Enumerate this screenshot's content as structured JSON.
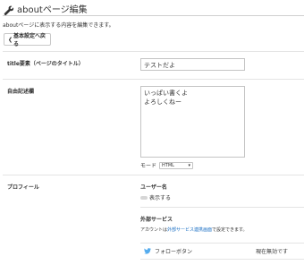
{
  "header": {
    "title": "aboutページ編集",
    "icon": "wrench-icon"
  },
  "description": "aboutページに表示する内容を編集できます。",
  "back_button": {
    "label": "基本設定へ戻る",
    "icon": "chevron-left-icon"
  },
  "form": {
    "title_label": "title要素（ページのタイトル）",
    "title_value": "テストだよ",
    "free_label": "自由記述欄",
    "free_value": "いっぱい書くよ\nよろしくねー",
    "mode_label": "モード",
    "mode_value": "HTML",
    "profile_label": "プロフィール",
    "username_heading": "ユーザー名",
    "show_label": "表示する",
    "external_heading": "外部サービス",
    "external_desc_prefix": "アカウントは",
    "external_desc_link": "外部サービス連携画面",
    "external_desc_suffix": "で設定できます。",
    "follow_label": "フォローボタン",
    "follow_status": "現在無効です"
  },
  "colors": {
    "link": "#1a6fc4",
    "twitter": "#55acee"
  }
}
